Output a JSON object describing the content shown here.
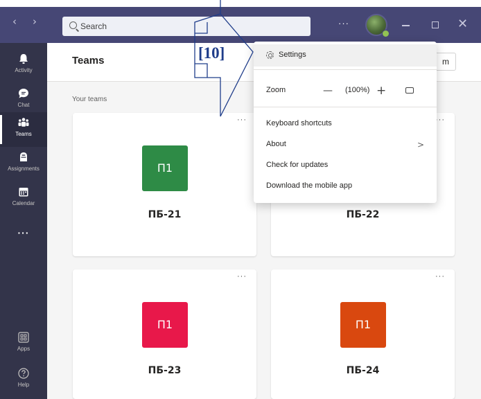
{
  "titlebar": {
    "back_glyph": "‹",
    "forward_glyph": "›",
    "search_placeholder": "Search",
    "more_glyph": "···",
    "avatar_icon": "user-avatar",
    "close_glyph": "✕"
  },
  "rail": {
    "items": [
      {
        "label": "Activity",
        "icon": "bell-icon"
      },
      {
        "label": "Chat",
        "icon": "chat-icon"
      },
      {
        "label": "Teams",
        "icon": "teams-icon",
        "active": true
      },
      {
        "label": "Assignments",
        "icon": "assignments-icon"
      },
      {
        "label": "Calendar",
        "icon": "calendar-icon"
      },
      {
        "label": "···",
        "icon": "more-icon"
      },
      {
        "label": "Apps",
        "icon": "apps-icon"
      },
      {
        "label": "Help",
        "icon": "help-icon"
      }
    ]
  },
  "main": {
    "title": "Teams",
    "right_button_text": "m",
    "section_label": "Your teams",
    "card_menu_glyph": "···",
    "teams": [
      {
        "tile": "П1",
        "name": "ПБ-21",
        "color": "#2e8b46"
      },
      {
        "tile": "П1",
        "name": "ПБ-22",
        "color": "#2e8b46"
      },
      {
        "tile": "П1",
        "name": "ПБ-23",
        "color": "#e8184a"
      },
      {
        "tile": "П1",
        "name": "ПБ-24",
        "color": "#d9480f"
      }
    ]
  },
  "menu": {
    "settings": "Settings",
    "zoom_label": "Zoom",
    "zoom_minus": "—",
    "zoom_value": "(100%)",
    "zoom_plus": "+",
    "keyboard_shortcuts": "Keyboard shortcuts",
    "about": "About",
    "about_chevron": ">",
    "check_updates": "Check for updates",
    "download_app": "Download the mobile app"
  },
  "annotation": {
    "label": "[10]",
    "color": "#1f3d8a"
  },
  "colors": {
    "titlebar": "#464775",
    "rail": "#33344a",
    "background": "#f5f5f5"
  }
}
